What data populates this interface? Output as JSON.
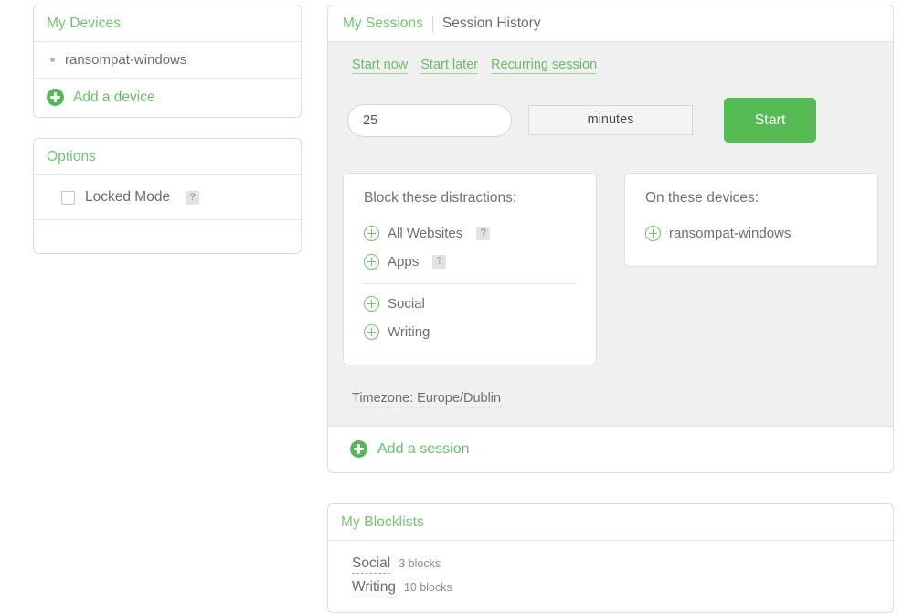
{
  "theme": {
    "accent_green": "#64c264",
    "button_green": "#57bb55",
    "body_gray": "#f0f0f0",
    "text_gray": "#6b6b6b"
  },
  "devices_panel": {
    "title": "My Devices",
    "devices": [
      {
        "name": "ransompat-windows"
      }
    ],
    "add_label": "Add a device"
  },
  "options_panel": {
    "title": "Options",
    "locked_mode_label": "Locked Mode",
    "help_badge": "?"
  },
  "sessions_panel": {
    "tab_active": "My Sessions",
    "tab_inactive": "Session History",
    "mode_links": [
      {
        "label": "Start now"
      },
      {
        "label": "Start later"
      },
      {
        "label": "Recurring session"
      }
    ],
    "duration": {
      "value": "25",
      "placeholder": "25"
    },
    "unit": "minutes",
    "start_label": "Start",
    "block_card": {
      "title": "Block these distractions:",
      "primary_items": [
        {
          "label": "All Websites",
          "help": "?"
        },
        {
          "label": "Apps",
          "help": "?"
        }
      ],
      "blocklist_items": [
        {
          "label": "Social"
        },
        {
          "label": "Writing"
        }
      ]
    },
    "devices_card": {
      "title": "On these devices:",
      "items": [
        {
          "label": "ransompat-windows"
        }
      ]
    },
    "timezone": "Timezone: Europe/Dublin",
    "add_session_label": "Add a session"
  },
  "blocklists_panel": {
    "title": "My Blocklists",
    "rows": [
      {
        "name": "Social",
        "count": "3 blocks"
      },
      {
        "name": "Writing",
        "count": "10 blocks"
      }
    ]
  }
}
